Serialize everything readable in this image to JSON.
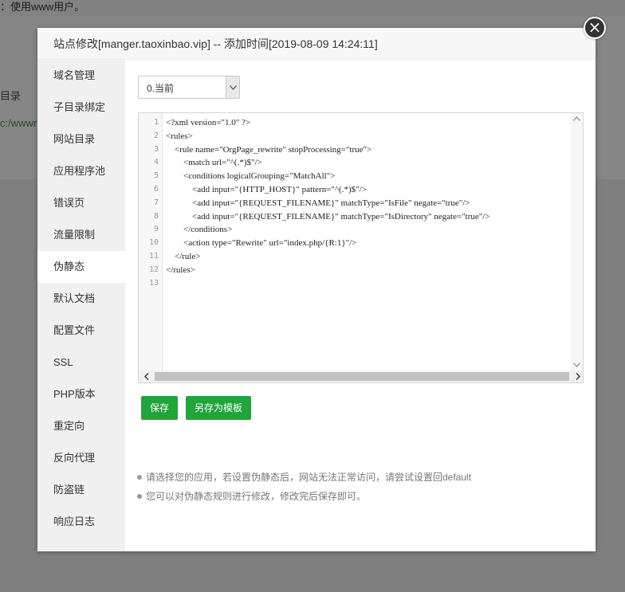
{
  "background": {
    "top_text": "：使用www用户。",
    "row_label": "目录",
    "row_link": "c:/wwwro"
  },
  "modal": {
    "title": "站点修改[manger.taoxinbao.vip] -- 添加时间[2019-08-09 14:24:11]",
    "close_glyph": "×"
  },
  "sidebar": {
    "items": [
      {
        "label": "域名管理"
      },
      {
        "label": "子目录绑定"
      },
      {
        "label": "网站目录"
      },
      {
        "label": "应用程序池"
      },
      {
        "label": "错误页"
      },
      {
        "label": "流量限制"
      },
      {
        "label": "伪静态",
        "active": true
      },
      {
        "label": "默认文档"
      },
      {
        "label": "配置文件"
      },
      {
        "label": "SSL"
      },
      {
        "label": "PHP版本"
      },
      {
        "label": "重定向"
      },
      {
        "label": "反向代理"
      },
      {
        "label": "防盗链"
      },
      {
        "label": "响应日志"
      }
    ]
  },
  "rewrite": {
    "select_value": "0.当前",
    "code_lines": [
      "<?xml version=\"1.0\" ?>",
      "<rules>",
      "    <rule name=\"OrgPage_rewrite\" stopProcessing=\"true\">",
      "        <match url=\"^(.*)$\"/>",
      "        <conditions logicalGrouping=\"MatchAll\">",
      "            <add input=\"{HTTP_HOST}\" pattern=\"^(.*)$\"/>",
      "            <add input=\"{REQUEST_FILENAME}\" matchType=\"IsFile\" negate=\"true\"/>",
      "            <add input=\"{REQUEST_FILENAME}\" matchType=\"IsDirectory\" negate=\"true\"/>",
      "        </conditions>",
      "        <action type=\"Rewrite\" url=\"index.php/{R:1}\"/>",
      "    </rule>",
      "</rules>",
      ""
    ],
    "line_numbers": [
      "1",
      "2",
      "3",
      "4",
      "5",
      "6",
      "7",
      "8",
      "9",
      "10",
      "11",
      "12",
      "13"
    ],
    "save_label": "保存",
    "save_template_label": "另存为模板",
    "tips": [
      "请选择您的应用，若设置伪静态后，网站无法正常访问，请尝试设置回default",
      "您可以对伪静态规则进行修改，修改完后保存即可。"
    ]
  },
  "colors": {
    "accent_green": "#20a53a",
    "sidebar_bg": "#f0f0f0"
  },
  "icons": {
    "close": "close-icon",
    "select_arrow": "chevron-down-icon"
  }
}
